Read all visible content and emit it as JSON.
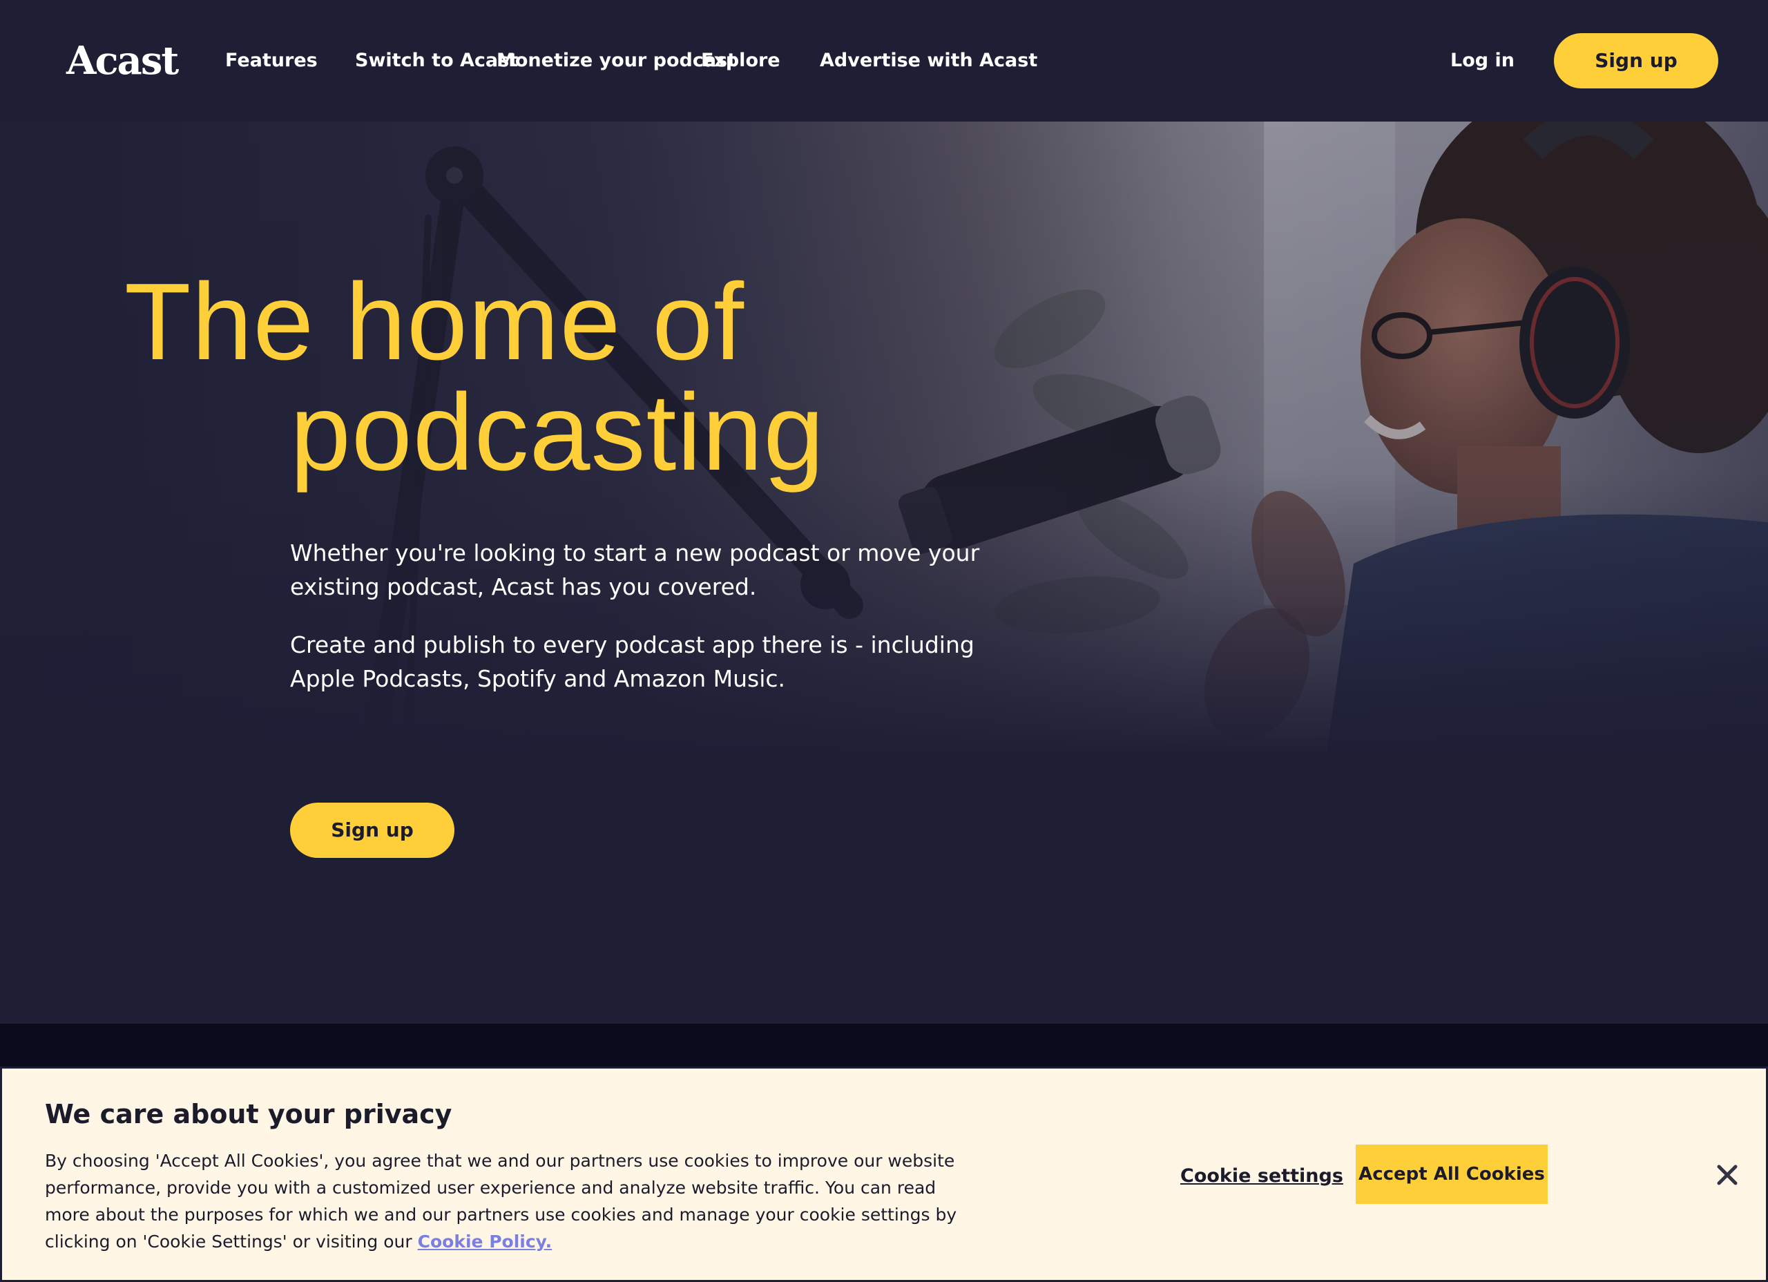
{
  "brand": {
    "name": "Acast"
  },
  "nav": {
    "items": [
      {
        "label": "Features"
      },
      {
        "label": "Switch to Acast"
      },
      {
        "label": "Monetize your podcast"
      },
      {
        "label": "Explore"
      },
      {
        "label": "Advertise with Acast"
      }
    ],
    "login_label": "Log in",
    "signup_label": "Sign up"
  },
  "hero": {
    "title_line1": "The home of",
    "title_line2": "podcasting",
    "paragraph1": "Whether you're looking to start a new podcast or move your existing podcast, Acast has you covered.",
    "paragraph2": "Create and publish to every podcast app there is - including Apple Podcasts, Spotify and Amazon Music.",
    "signup_label": "Sign up"
  },
  "cookie_banner": {
    "title": "We care about your privacy",
    "text": "By choosing 'Accept All Cookies', you agree that we and our partners use cookies to improve our website performance, provide you with a customized user experience and analyze website traffic. You can read more about the purposes for which we and our partners use cookies and manage your cookie settings by clicking on 'Cookie Settings' or visiting our",
    "policy_link_label": "Cookie Policy.",
    "settings_label": "Cookie settings",
    "accept_label": "Accept All Cookies",
    "close_icon": "close-icon"
  },
  "colors": {
    "background": "#1e1e35",
    "accent": "#ffcf3a",
    "banner_background": "#fff6e6",
    "link": "#7a7fe0",
    "dark_strip": "#0a0a1c"
  }
}
